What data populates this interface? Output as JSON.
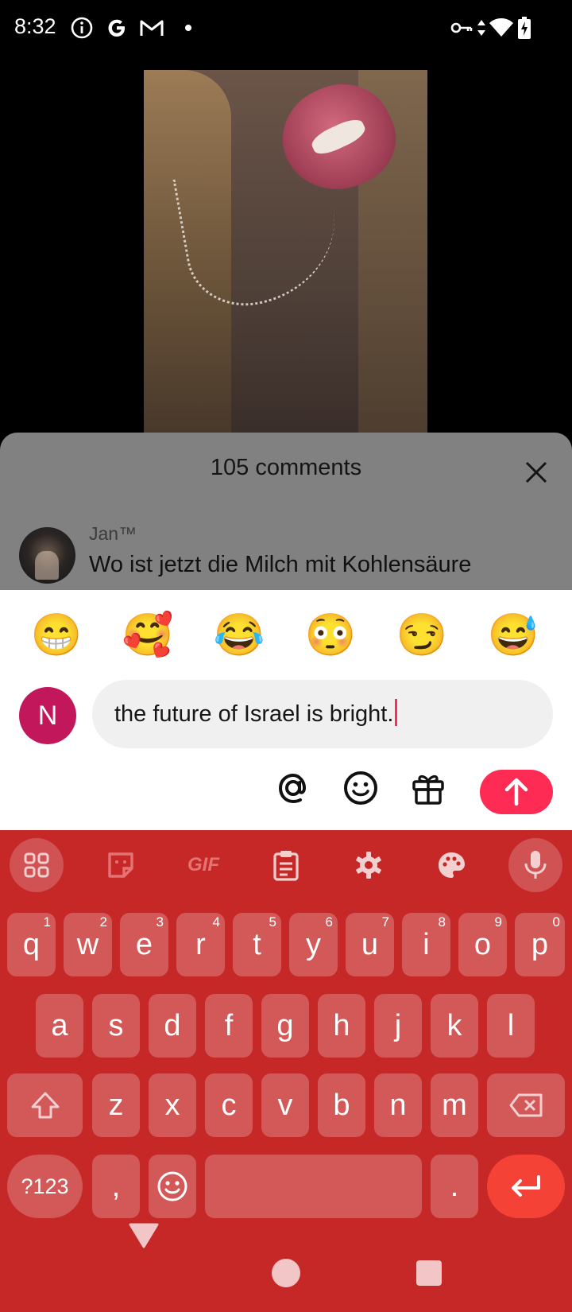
{
  "status_bar": {
    "time": "8:32",
    "left_icons": [
      "info-icon",
      "google-icon",
      "gmail-icon",
      "dot-icon"
    ],
    "right_icons": [
      "vpn-key-icon",
      "data-arrows-icon",
      "wifi-icon",
      "battery-charging-icon"
    ]
  },
  "comments": {
    "title": "105 comments",
    "items": [
      {
        "user": "Jan™",
        "text": "Wo ist jetzt die Milch mit Kohlensäure"
      }
    ]
  },
  "quick_emojis": [
    "😁",
    "🥰",
    "😂",
    "😳",
    "😏",
    "😅"
  ],
  "compose": {
    "avatar_letter": "N",
    "avatar_color": "#c2185b",
    "input_value": "the future of Israel is bright.",
    "tools": [
      "mention-icon",
      "emoji-icon",
      "gift-icon"
    ],
    "send_color": "#fe2c55"
  },
  "keyboard": {
    "background": "#c62828",
    "toolbar": [
      "apps-icon",
      "sticker-icon",
      "gif-icon",
      "clipboard-icon",
      "settings-icon",
      "palette-icon",
      "microphone-icon"
    ],
    "gif_label": "GIF",
    "row1": [
      {
        "k": "q",
        "h": "1"
      },
      {
        "k": "w",
        "h": "2"
      },
      {
        "k": "e",
        "h": "3"
      },
      {
        "k": "r",
        "h": "4"
      },
      {
        "k": "t",
        "h": "5"
      },
      {
        "k": "y",
        "h": "6"
      },
      {
        "k": "u",
        "h": "7"
      },
      {
        "k": "i",
        "h": "8"
      },
      {
        "k": "o",
        "h": "9"
      },
      {
        "k": "p",
        "h": "0"
      }
    ],
    "row2": [
      "a",
      "s",
      "d",
      "f",
      "g",
      "h",
      "j",
      "k",
      "l"
    ],
    "row3": [
      "z",
      "x",
      "c",
      "v",
      "b",
      "n",
      "m"
    ],
    "symbols_label": "?123",
    "comma": ",",
    "period": "."
  },
  "nav_bar": [
    "back-icon",
    "home-icon",
    "recents-icon"
  ]
}
